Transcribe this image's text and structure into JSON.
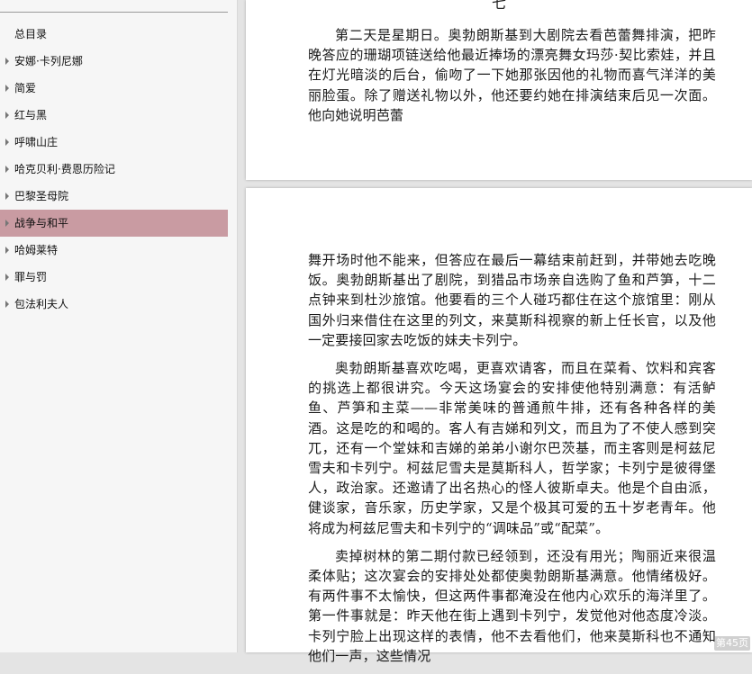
{
  "toc": {
    "root_label": "总目录",
    "items": [
      {
        "label": "安娜·卡列尼娜",
        "selected": false
      },
      {
        "label": "简爱",
        "selected": false
      },
      {
        "label": "红与黑",
        "selected": false
      },
      {
        "label": "呼啸山庄",
        "selected": false
      },
      {
        "label": "哈克贝利·费恩历险记",
        "selected": false
      },
      {
        "label": "巴黎圣母院",
        "selected": false
      },
      {
        "label": "战争与和平",
        "selected": true
      },
      {
        "label": "哈姆莱特",
        "selected": false
      },
      {
        "label": "罪与罚",
        "selected": false
      },
      {
        "label": "包法利夫人",
        "selected": false
      }
    ],
    "selected_color": "#c99ba2"
  },
  "page1": {
    "chapter_number": "七",
    "paragraphs": [
      "第二天是星期日。奥勃朗斯基到大剧院去看芭蕾舞排演，把昨晚答应的珊瑚项链送给他最近捧场的漂亮舞女玛莎·契比索娃，并且在灯光暗淡的后台，偷吻了一下她那张因他的礼物而喜气洋洋的美丽脸蛋。除了赠送礼物以外，他还要约她在排演结束后见一次面。他向她说明芭蕾"
    ]
  },
  "page2": {
    "paragraphs": [
      {
        "indent": false,
        "text": "舞开场时他不能来，但答应在最后一幕结束前赶到，并带她去吃晚饭。奥勃朗斯基出了剧院，到猎品市场亲自选购了鱼和芦笋，十二点钟来到杜沙旅馆。他要看的三个人碰巧都住在这个旅馆里：刚从国外归来借住在这里的列文，来莫斯科视察的新上任长官，以及他一定要接回家去吃饭的妹夫卡列宁。"
      },
      {
        "indent": true,
        "text": "奥勃朗斯基喜欢吃喝，更喜欢请客，而且在菜肴、饮料和宾客的挑选上都很讲究。今天这场宴会的安排使他特别满意：有活鲈鱼、芦笋和主菜——非常美味的普通煎牛排，还有各种各样的美酒。这是吃的和喝的。客人有吉娣和列文，而且为了不使人感到突兀，还有一个堂妹和吉娣的弟弟小谢尔巴茨基，而主客则是柯兹尼雪夫和卡列宁。柯兹尼雪夫是莫斯科人，哲学家；卡列宁是彼得堡人，政治家。还邀请了出名热心的怪人彼斯卓夫。他是个自由派，健谈家，音乐家，历史学家，又是个极其可爱的五十岁老青年。他将成为柯兹尼雪夫和卡列宁的“调味品”或“配菜”。"
      },
      {
        "indent": true,
        "text": "卖掉树林的第二期付款已经领到，还没有用光；陶丽近来很温柔体贴；这次宴会的安排处处都使奥勃朗斯基满意。他情绪极好。有两件事不太愉快，但这两件事都淹没在他内心欢乐的海洋里了。第一件事就是：昨天他在街上遇到卡列宁，发觉他对他态度冷淡。卡列宁脸上出现这样的表情，他不去看他们，他来莫斯科也不通知他们一声，这些情况"
      }
    ],
    "page_badge": "第45页"
  }
}
